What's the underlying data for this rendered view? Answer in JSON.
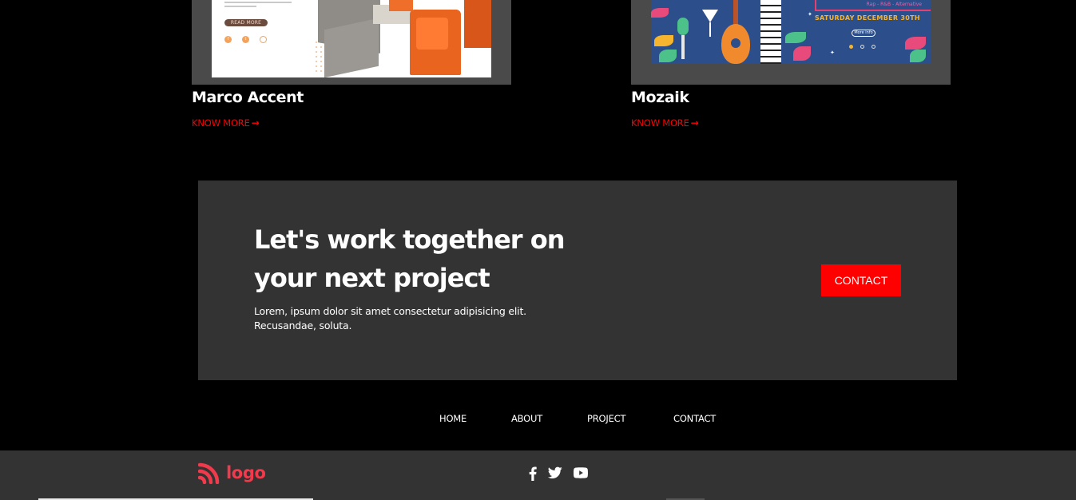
{
  "projects": [
    {
      "title": "Marco Accent",
      "link_label": "KNOW MORE",
      "thumb": {
        "button_label": "READ MORE"
      }
    },
    {
      "title": "Mozaik",
      "link_label": "KNOW MORE",
      "thumb": {
        "date_text": "SATURDAY DECEMBER 30TH",
        "genre_text": "Rap - R&B - Alternative",
        "button_label": "More info"
      }
    }
  ],
  "cta": {
    "title_line1": "Let's work together on",
    "title_line2": "your next project",
    "description_line1": "Lorem, ipsum dolor sit amet consectetur adipisicing elit.",
    "description_line2": "Recusandae, soluta.",
    "button_label": "CONTACT"
  },
  "nav": {
    "items": [
      {
        "label": "HOME"
      },
      {
        "label": "ABOUT"
      },
      {
        "label": "PROJECT"
      },
      {
        "label": "CONTACT"
      }
    ]
  },
  "footer": {
    "logo_text": "logo",
    "socials": [
      "facebook-icon",
      "twitter-icon",
      "youtube-icon"
    ]
  },
  "colors": {
    "accent": "#ff0000",
    "logo": "#f23a4c",
    "panel": "#333333",
    "background": "#000000"
  }
}
